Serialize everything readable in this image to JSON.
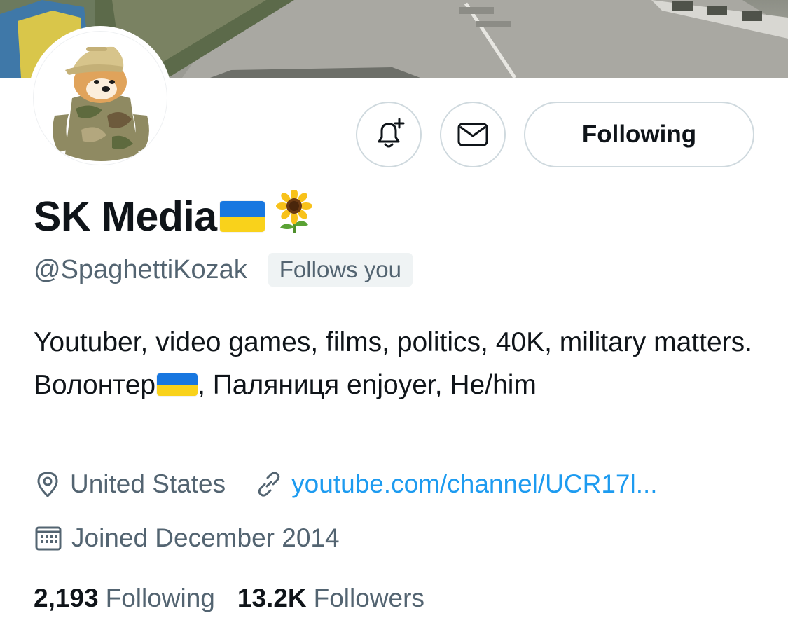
{
  "profile": {
    "display_name": "SK Media",
    "handle": "@SpaghettiKozak",
    "follows_you": "Follows you",
    "bio_part1": "Youtuber, video games, films, politics, 40K, military matters. Волонтер",
    "bio_part2": ", Паляниця enjoyer, He/him",
    "location": "United States",
    "website": "youtube.com/channel/UCR17l...",
    "joined": "Joined December 2014"
  },
  "actions": {
    "following_label": "Following"
  },
  "stats": {
    "following_count": "2,193",
    "following_label": "Following",
    "followers_count": "13.2K",
    "followers_label": "Followers"
  },
  "icons": {
    "notify": "bell-plus-icon",
    "message": "envelope-icon",
    "location": "map-pin-icon",
    "website": "link-icon",
    "joined": "calendar-icon",
    "name_emoji": [
      "ukraine-flag-icon",
      "sunflower-icon"
    ]
  },
  "colors": {
    "text_primary": "#0f1419",
    "text_secondary": "#536471",
    "link": "#1d9bf0",
    "border": "#cfd9de",
    "badge_bg": "#eff3f4",
    "flag_blue": "#1877e0",
    "flag_yellow": "#f9d21b"
  }
}
